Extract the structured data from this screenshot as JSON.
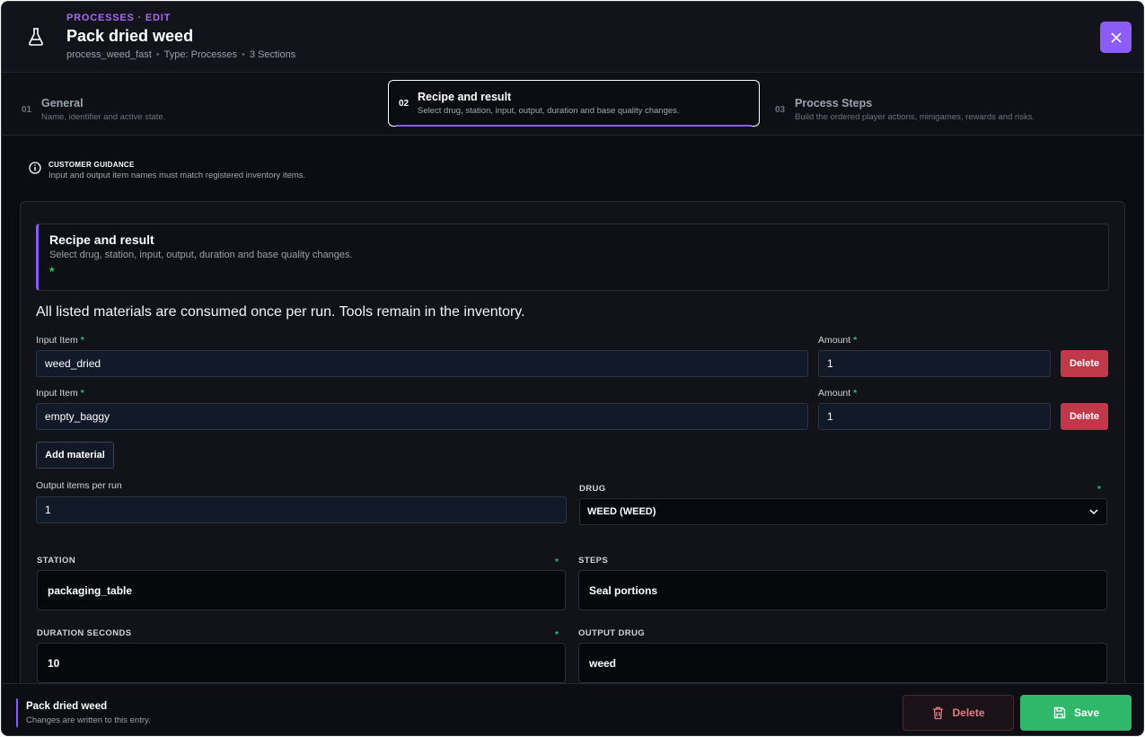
{
  "header": {
    "eyebrow": "PROCESSES · EDIT",
    "title": "Pack dried weed",
    "meta_id": "process_weed_fast",
    "meta_type": "Type: Processes",
    "meta_sections": "3 Sections",
    "accent_color": "#8b5cf6"
  },
  "steps": [
    {
      "num": "01",
      "label": "General",
      "desc": "Name, identifier and active state."
    },
    {
      "num": "02",
      "label": "Recipe and result",
      "desc": "Select drug, station, input, output, duration and base quality changes."
    },
    {
      "num": "03",
      "label": "Process Steps",
      "desc": "Build the ordered player actions, minigames, rewards and risks."
    }
  ],
  "guidance": {
    "title": "CUSTOMER GUIDANCE",
    "text": "Input and output item names must match registered inventory items."
  },
  "section": {
    "title": "Recipe and result",
    "desc": "Select drug, station, input, output, duration and base quality changes.",
    "required_mark": "*"
  },
  "note": "All listed materials are consumed once per run. Tools remain in the inventory.",
  "materials": [
    {
      "input_label": "Input Item",
      "input_value": "weed_dried",
      "amount_label": "Amount",
      "amount_value": "1",
      "delete_label": "Delete"
    },
    {
      "input_label": "Input Item",
      "input_value": "empty_baggy",
      "amount_label": "Amount",
      "amount_value": "1",
      "delete_label": "Delete"
    }
  ],
  "add_material_label": "Add material",
  "output_items": {
    "label": "Output items per run",
    "value": "1"
  },
  "drug": {
    "label": "DRUG",
    "value": "WEED (WEED)"
  },
  "station": {
    "label": "STATION",
    "value": "packaging_table"
  },
  "steps_field": {
    "label": "STEPS",
    "value": "Seal portions"
  },
  "duration": {
    "label": "DURATION SECONDS",
    "value": "10"
  },
  "output_drug": {
    "label": "OUTPUT DRUG",
    "value": "weed"
  },
  "required_star": "*",
  "footer": {
    "title": "Pack dried weed",
    "desc": "Changes are written to this entry.",
    "delete_label": "Delete",
    "save_label": "Save",
    "save_color": "#2fb86a",
    "delete_color": "#e57b86"
  }
}
